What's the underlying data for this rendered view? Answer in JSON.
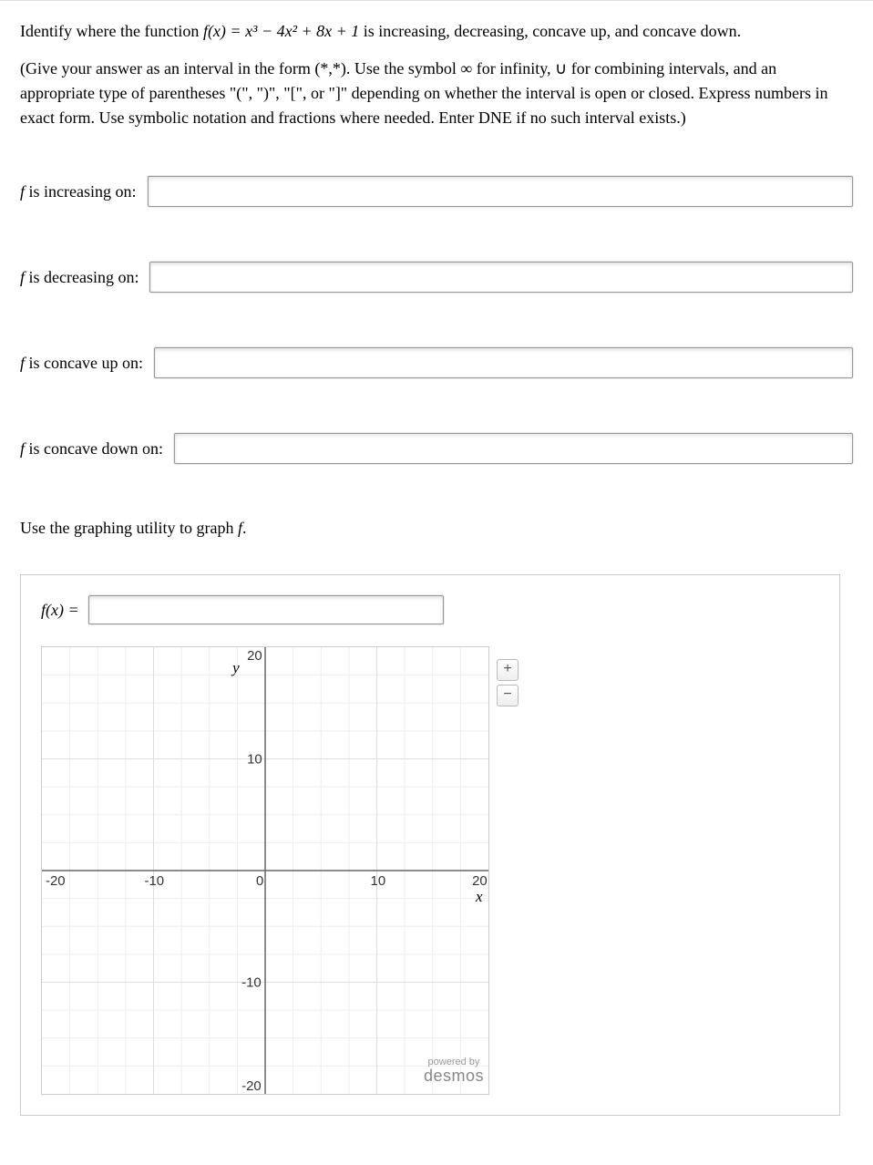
{
  "question": {
    "prefix": "Identify where the function ",
    "func_lhs": "f(x) = ",
    "func_rhs": "x³ − 4x² + 8x + 1",
    "suffix": " is increasing, decreasing, concave up, and concave down."
  },
  "instructions": "(Give your answer as an interval in the form (*,*). Use the symbol ∞ for infinity, ∪ for combining intervals, and an appropriate type of parentheses \"(\", \")\", \"[\", or \"]\" depending on whether the interval is open or closed. Express numbers in exact form. Use symbolic notation and fractions where needed. Enter DNE if no such interval exists.)",
  "fields": {
    "increasing": {
      "label": "f is increasing on:",
      "value": ""
    },
    "decreasing": {
      "label": "f is decreasing on:",
      "value": ""
    },
    "concave_up": {
      "label": "f is concave up on:",
      "value": ""
    },
    "concave_down": {
      "label": "f is concave down on:",
      "value": ""
    }
  },
  "use_graph": "Use the graphing utility to graph f.",
  "fx": {
    "label": "f(x) =",
    "value": ""
  },
  "graph": {
    "x_label": "x",
    "y_label": "y",
    "ticks_x": [
      "-20",
      "-10",
      "0",
      "10",
      "20"
    ],
    "ticks_y": [
      "20",
      "10",
      "-10",
      "-20"
    ],
    "zoom_in": "+",
    "zoom_out": "−",
    "powered_by": "powered by",
    "brand": "desmos"
  },
  "chart_data": {
    "type": "scatter",
    "title": "",
    "xlabel": "x",
    "ylabel": "y",
    "xlim": [
      -20,
      20
    ],
    "ylim": [
      -20,
      20
    ],
    "x_ticks": [
      -20,
      -10,
      0,
      10,
      20
    ],
    "y_ticks": [
      -20,
      -10,
      0,
      10,
      20
    ],
    "grid_major": 5,
    "grid_minor": 2.5,
    "series": []
  }
}
